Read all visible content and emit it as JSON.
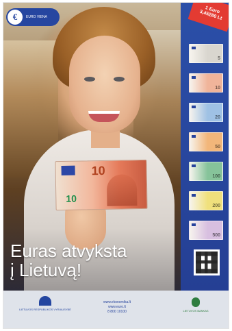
{
  "logo": {
    "letter": "€",
    "text": "EURO VIENA"
  },
  "ribbon": {
    "line1": "1 Euro",
    "line2": "3,45280 Lt"
  },
  "banknote": {
    "denomination": "10",
    "small_denomination": "10"
  },
  "headline": {
    "line1": "Euras atvyksta",
    "line2": "į Lietuvą!"
  },
  "side_notes": [
    {
      "denomination": "5",
      "color": "#d9d6cf"
    },
    {
      "denomination": "10",
      "color": "#f0b49a"
    },
    {
      "denomination": "20",
      "color": "#9fc1e4"
    },
    {
      "denomination": "50",
      "color": "#f2b67a"
    },
    {
      "denomination": "100",
      "color": "#86c39a"
    },
    {
      "denomination": "200",
      "color": "#f0e07c"
    },
    {
      "denomination": "500",
      "color": "#d8bfe0"
    }
  ],
  "footer": {
    "left_text": "LIETUVOS RESPUBLIKOS VYRIAUSYBĖ",
    "center_lines": [
      "www.ekonomika.lt",
      "www.euro.lt",
      "8 800 10100"
    ],
    "right_text": "LIETUVOS BANKAS"
  },
  "colors": {
    "brand_blue": "#2b4fa8",
    "ribbon_red": "#e33b32"
  }
}
